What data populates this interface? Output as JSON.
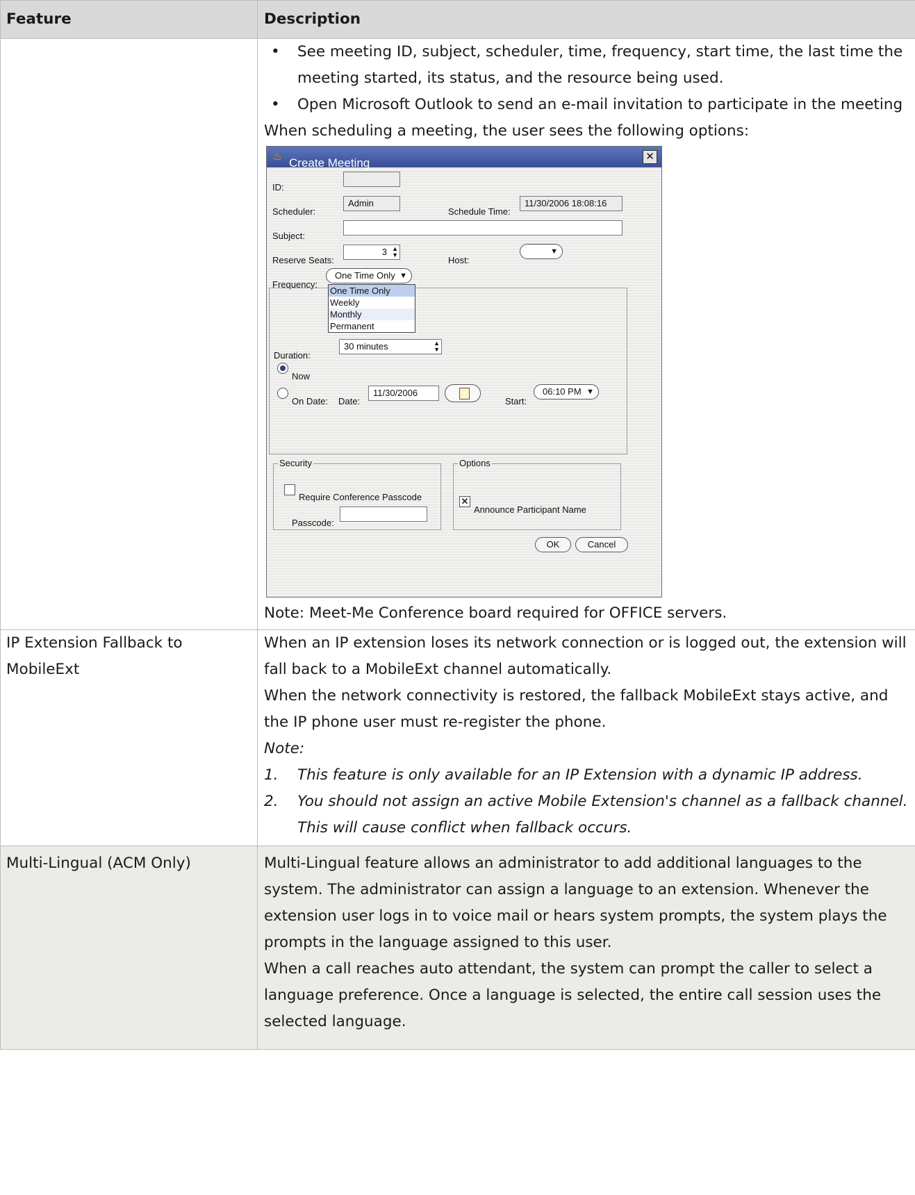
{
  "table": {
    "headers": [
      "Feature",
      "Description"
    ],
    "row1": {
      "feature": "",
      "bullets": [
        "See meeting ID, subject, scheduler, time, frequency, start time, the last time the meeting started, its status, and the resource being used.",
        "Open Microsoft Outlook to send an e-mail invitation to participate in the meeting"
      ],
      "intro": "When scheduling a meeting, the user sees the following options:",
      "note": " Note: Meet-Me Conference board required for OFFICE servers."
    },
    "row2": {
      "feature": "IP Extension Fallback to MobileExt",
      "para1": "When an IP extension loses its network connection or is logged out, the extension will fall back to a MobileExt channel automatically.",
      "para2": "When the network connectivity is restored, the fallback MobileExt stays active, and the IP phone user must re-register the phone.",
      "note_label": "Note:",
      "notes": [
        {
          "num": "1.",
          "text": "This feature is only available for an IP Extension with a dynamic IP address."
        },
        {
          "num": "2.",
          "text": "You should not assign an active Mobile Extension's channel as a fallback channel. This will cause conflict when fallback occurs."
        }
      ]
    },
    "row3": {
      "feature": "Multi-Lingual (ACM Only)",
      "para1": "Multi-Lingual feature allows an administrator to add additional languages to the system.  The administrator can assign a language to an extension. Whenever the extension user logs in to voice mail or hears system prompts, the system plays the prompts in the language assigned to this user.",
      "para2": "When a call reaches auto attendant, the system can prompt the caller to select a language preference. Once a language is selected, the entire call session uses the selected language."
    }
  },
  "dialog": {
    "title": "Create Meeting",
    "labels": {
      "id": "ID:",
      "scheduler": "Scheduler:",
      "schedule_time": "Schedule Time:",
      "subject": "Subject:",
      "reserve_seats": "Reserve Seats:",
      "host": "Host:",
      "frequency": "Frequency:",
      "duration": "Duration:",
      "now": "Now",
      "on_date": "On Date:",
      "date": "Date:",
      "start": "Start:",
      "security": "Security",
      "options": "Options",
      "require_passcode": "Require Conference Passcode",
      "passcode": "Passcode:",
      "announce": "Announce Participant Name"
    },
    "values": {
      "id": "",
      "scheduler": "Admin",
      "schedule_time": "11/30/2006 18:08:16",
      "subject": "",
      "reserve_seats": "3",
      "host": "",
      "frequency": "One Time Only",
      "duration": "30 minutes",
      "date": "11/30/2006",
      "start": "06:10 PM",
      "passcode": ""
    },
    "frequency_options": [
      "One Time Only",
      "Weekly",
      "Monthly",
      "Permanent"
    ],
    "now_selected": true,
    "require_passcode_checked": false,
    "announce_checked": true,
    "buttons": {
      "ok": "OK",
      "cancel": "Cancel"
    }
  }
}
